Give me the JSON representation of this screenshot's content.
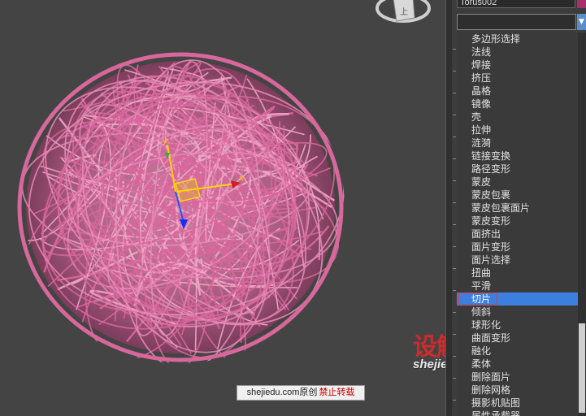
{
  "viewport": {
    "watermark_site": "shejiedu.com",
    "watermark_original": "原创",
    "watermark_warning": "禁止转载",
    "gizmo_x_label": "x",
    "gizmo_y_label": "y",
    "viewcube_label": "上",
    "logo_text": "设解读",
    "logo_subtext": "shejiedu.com",
    "ball_color": "#d8679c"
  },
  "panel": {
    "object_name": "Torus002",
    "object_color": "#a8306a"
  },
  "modifier_list": {
    "items": [
      {
        "label": "多边形选择"
      },
      {
        "label": "法线"
      },
      {
        "label": "焊接"
      },
      {
        "label": "挤压"
      },
      {
        "label": "晶格"
      },
      {
        "label": "镜像"
      },
      {
        "label": "壳"
      },
      {
        "label": "拉伸"
      },
      {
        "label": "涟漪"
      },
      {
        "label": "链接变换"
      },
      {
        "label": "路径变形"
      },
      {
        "label": "蒙皮"
      },
      {
        "label": "蒙皮包裹"
      },
      {
        "label": "蒙皮包裹面片"
      },
      {
        "label": "蒙皮变形"
      },
      {
        "label": "面挤出"
      },
      {
        "label": "面片变形"
      },
      {
        "label": "面片选择"
      },
      {
        "label": "扭曲"
      },
      {
        "label": "平滑"
      },
      {
        "label": "切片"
      },
      {
        "label": "倾斜"
      },
      {
        "label": "球形化"
      },
      {
        "label": "曲面变形"
      },
      {
        "label": "融化"
      },
      {
        "label": "柔体"
      },
      {
        "label": "删除面片"
      },
      {
        "label": "删除网格"
      },
      {
        "label": "摄影机贴图"
      },
      {
        "label": "属性承载器"
      }
    ],
    "selected": "切片"
  }
}
